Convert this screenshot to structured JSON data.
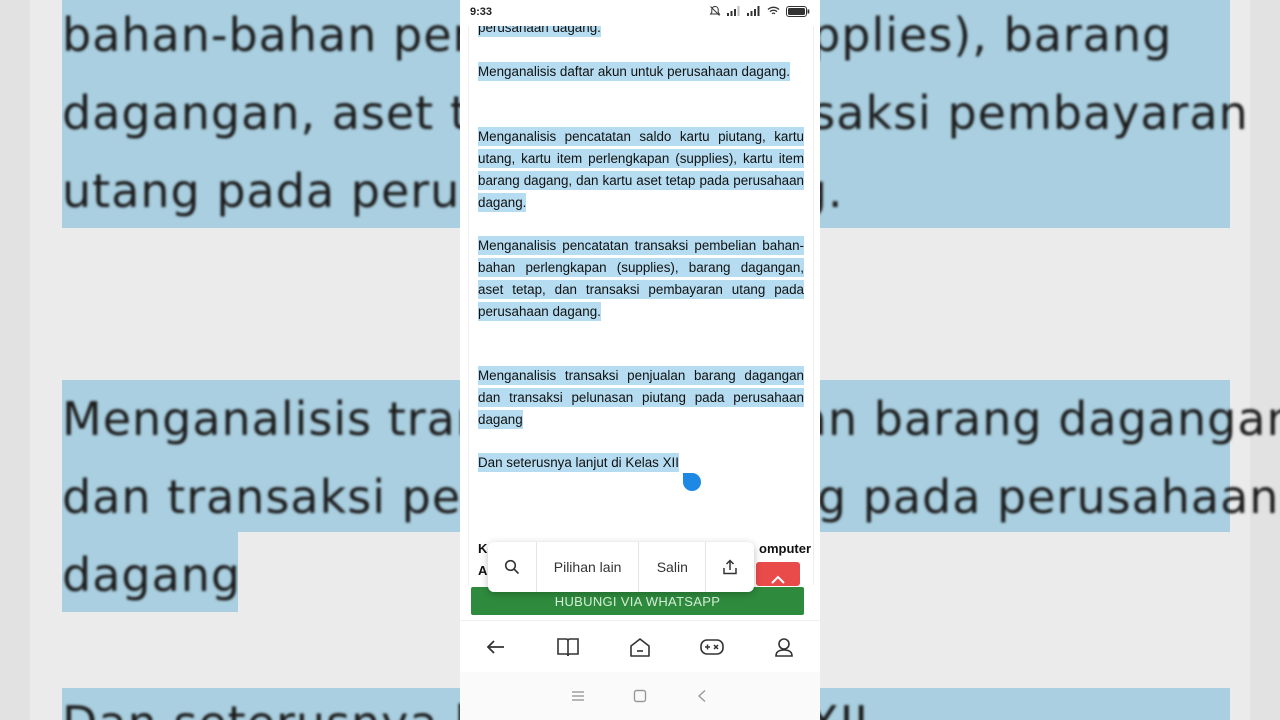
{
  "status_bar": {
    "time": "9:33"
  },
  "background_zoom": {
    "lines": [
      "bahan-bahan    perlengkapan (supplies),    barang",
      "dagangan,  aset  tetap,  dan  transaksi  pembayaran",
      "utang pada perusahaan dagang.",
      "Menganalisis transaksi penjualan barang dagangan",
      "dan transaksi pelunasan piutang  pada perusahaan",
      "dagang",
      "Dan seterusnya lanjut di Kelas XII"
    ]
  },
  "article": {
    "p0": "perusahaan dagang.",
    "p1": "Menganalisis daftar akun untuk perusahaan dagang.",
    "p2": "Menganalisis pencatatan saldo kartu piutang, kartu utang, kartu item perlengkapan (supplies), kartu item barang dagang, dan kartu aset tetap pada perusahaan dagang.",
    "p3": "Menganalisis pencatatan transaksi pembelian bahan-bahan perlengkapan (supplies), barang dagangan, aset tetap, dan transaksi pembayaran utang pada perusahaan dagang.",
    "p4": "Menganalisis transaksi penjualan barang dagangan dan transaksi pelunasan piutang  pada perusahaan dagang",
    "p5": "Dan seterusnya lanjut di Kelas XII",
    "partial_left_1": "Ke",
    "partial_left_2": "Al",
    "partial_right": "omputer"
  },
  "selection_popup": {
    "search_icon": "search-icon",
    "more_options": "Pilihan lain",
    "copy": "Salin",
    "share_icon": "share-icon"
  },
  "whatsapp_button": "HUBUNGI VIA WHATSAPP",
  "bottom_nav": [
    "back-arrow-icon",
    "book-icon",
    "home-icon",
    "gamepad-icon",
    "profile-icon"
  ],
  "system_nav": [
    "menu-icon",
    "square-icon",
    "back-icon"
  ],
  "colors": {
    "highlight": "#b5dcf0",
    "handle": "#1e88e5",
    "whatsapp": "#2e8b3d",
    "red_button": "#e94a4a"
  }
}
